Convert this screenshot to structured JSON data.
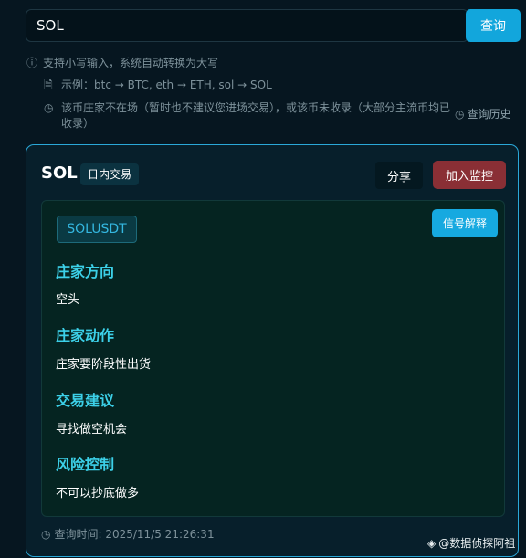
{
  "search": {
    "value": "SOL",
    "button_label": "查询"
  },
  "hints": {
    "line1": "支持小写输入，系统自动转换为大写",
    "line2": "示例：btc → BTC, eth → ETH, sol → SOL",
    "line3": "该币庄家不在场（暂时也不建议您进场交易），或该币未收录（大部分主流币均已收录）",
    "history_label": "查询历史"
  },
  "card": {
    "coin": "SOL",
    "tag": "日内交易",
    "share_label": "分享",
    "monitor_label": "加入监控",
    "pair": "SOLUSDT",
    "explain_label": "信号解释",
    "sections": [
      {
        "title": "庄家方向",
        "text": "空头"
      },
      {
        "title": "庄家动作",
        "text": "庄家要阶段性出货"
      },
      {
        "title": "交易建议",
        "text": "寻找做空机会"
      },
      {
        "title": "风险控制",
        "text": "不可以抄底做多"
      }
    ],
    "query_time": "查询时间: 2025/11/5 21:26:31"
  },
  "watermark": "@数据侦探阿祖",
  "colors": {
    "background": "#061620",
    "accent": "#12a6dc",
    "monitor_button": "#8a2f35",
    "section_title": "#3cd0e8"
  },
  "icons": {
    "info": "info-icon",
    "document": "document-icon",
    "clock": "clock-icon",
    "watermark": "binance-logo-icon"
  }
}
